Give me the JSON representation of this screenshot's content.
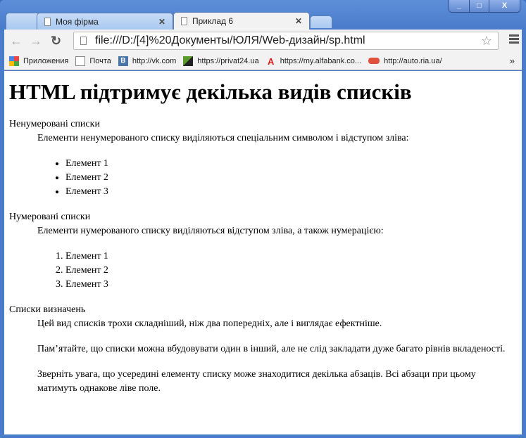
{
  "window": {
    "controls": [
      "minimize",
      "maximize",
      "close"
    ]
  },
  "tabs": [
    {
      "label": "Моя фірма"
    },
    {
      "label": "Приклад 6",
      "active": true
    }
  ],
  "address": {
    "url": "file:///D:/[4]%20Документы/ЮЛЯ/Web-дизайн/sp.html"
  },
  "bookmarks": [
    {
      "label": "Приложения",
      "icon": "apps-icon"
    },
    {
      "label": "Почта",
      "icon": "page-icon"
    },
    {
      "label": "http://vk.com",
      "icon": "vk-icon",
      "color": "#4a76a8"
    },
    {
      "label": "https://privat24.ua",
      "icon": "privat-icon",
      "color": "#5a9a2a"
    },
    {
      "label": "https://my.alfabank.co...",
      "icon": "alfabank-icon",
      "color": "#e21a1a"
    },
    {
      "label": "http://auto.ria.ua/",
      "icon": "car-icon",
      "color": "#e0503c"
    }
  ],
  "page": {
    "title": "HTML підтримує декілька видів списків",
    "s1": {
      "term": "Ненумеровані списки",
      "desc": "Елементи ненумерованого списку виділяються спеціальним символом і відступом зліва:",
      "items": [
        "Елемент 1",
        "Елемент 2",
        "Елемент 3"
      ]
    },
    "s2": {
      "term": "Нумеровані списки",
      "desc": "Елементи нумерованого списку виділяються відступом зліва, а також нумерацією:",
      "items": [
        "Елемент 1",
        "Елемент 2",
        "Елемент 3"
      ]
    },
    "s3": {
      "term": "Списки визначень",
      "paras": [
        "Цей вид списків трохи складніший, ніж два попередніх, але і виглядає ефектніше.",
        "Пам’ятайте, що списки можна вбудовувати один в інший, але не слід закладати дуже багато рівнів вкладеності.",
        "Зверніть увага, що усередині елементу списку може знаходитися декілька абзаців. Всі абзаци при цьому матимуть однакове ліве поле."
      ]
    }
  }
}
